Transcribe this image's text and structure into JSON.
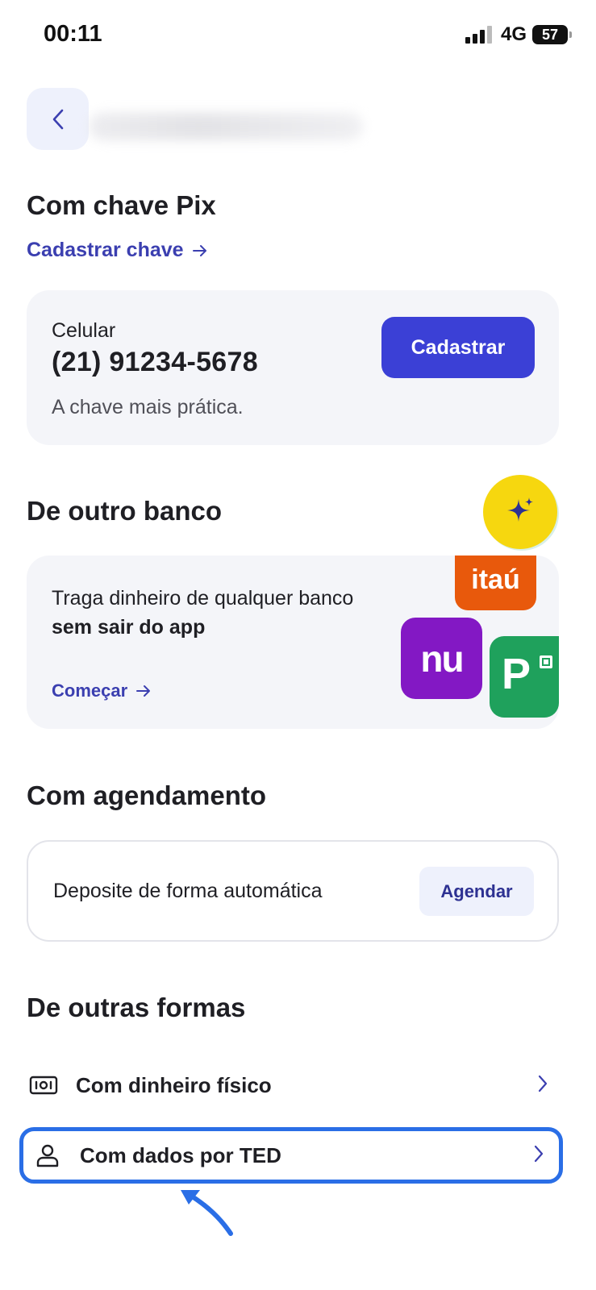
{
  "status_bar": {
    "time": "00:11",
    "network": "4G",
    "battery": "57"
  },
  "sections": {
    "pix": {
      "title": "Com chave Pix",
      "link_label": "Cadastrar chave",
      "card": {
        "label": "Celular",
        "value": "(21) 91234-5678",
        "description": "A chave mais prática.",
        "button_label": "Cadastrar"
      }
    },
    "other_bank": {
      "title": "De outro banco",
      "text_regular": "Traga dinheiro de qualquer banco ",
      "text_bold": "sem sair do app",
      "link_label": "Começar",
      "logos": {
        "itau": "itaú",
        "nu": "nu",
        "picpay": "P"
      }
    },
    "scheduling": {
      "title": "Com agendamento",
      "text": "Deposite de forma automática",
      "button_label": "Agendar"
    },
    "other_ways": {
      "title": "De outras formas",
      "items": [
        {
          "label": "Com dinheiro físico",
          "icon": "cash-icon"
        },
        {
          "label": "Com dados por TED",
          "icon": "person-icon"
        }
      ]
    }
  },
  "colors": {
    "primary": "#3b40d6",
    "link": "#3b3fb0",
    "card_bg": "#f4f5f9",
    "highlight_border": "#2a6ee6",
    "badge": "#f6d70f"
  }
}
